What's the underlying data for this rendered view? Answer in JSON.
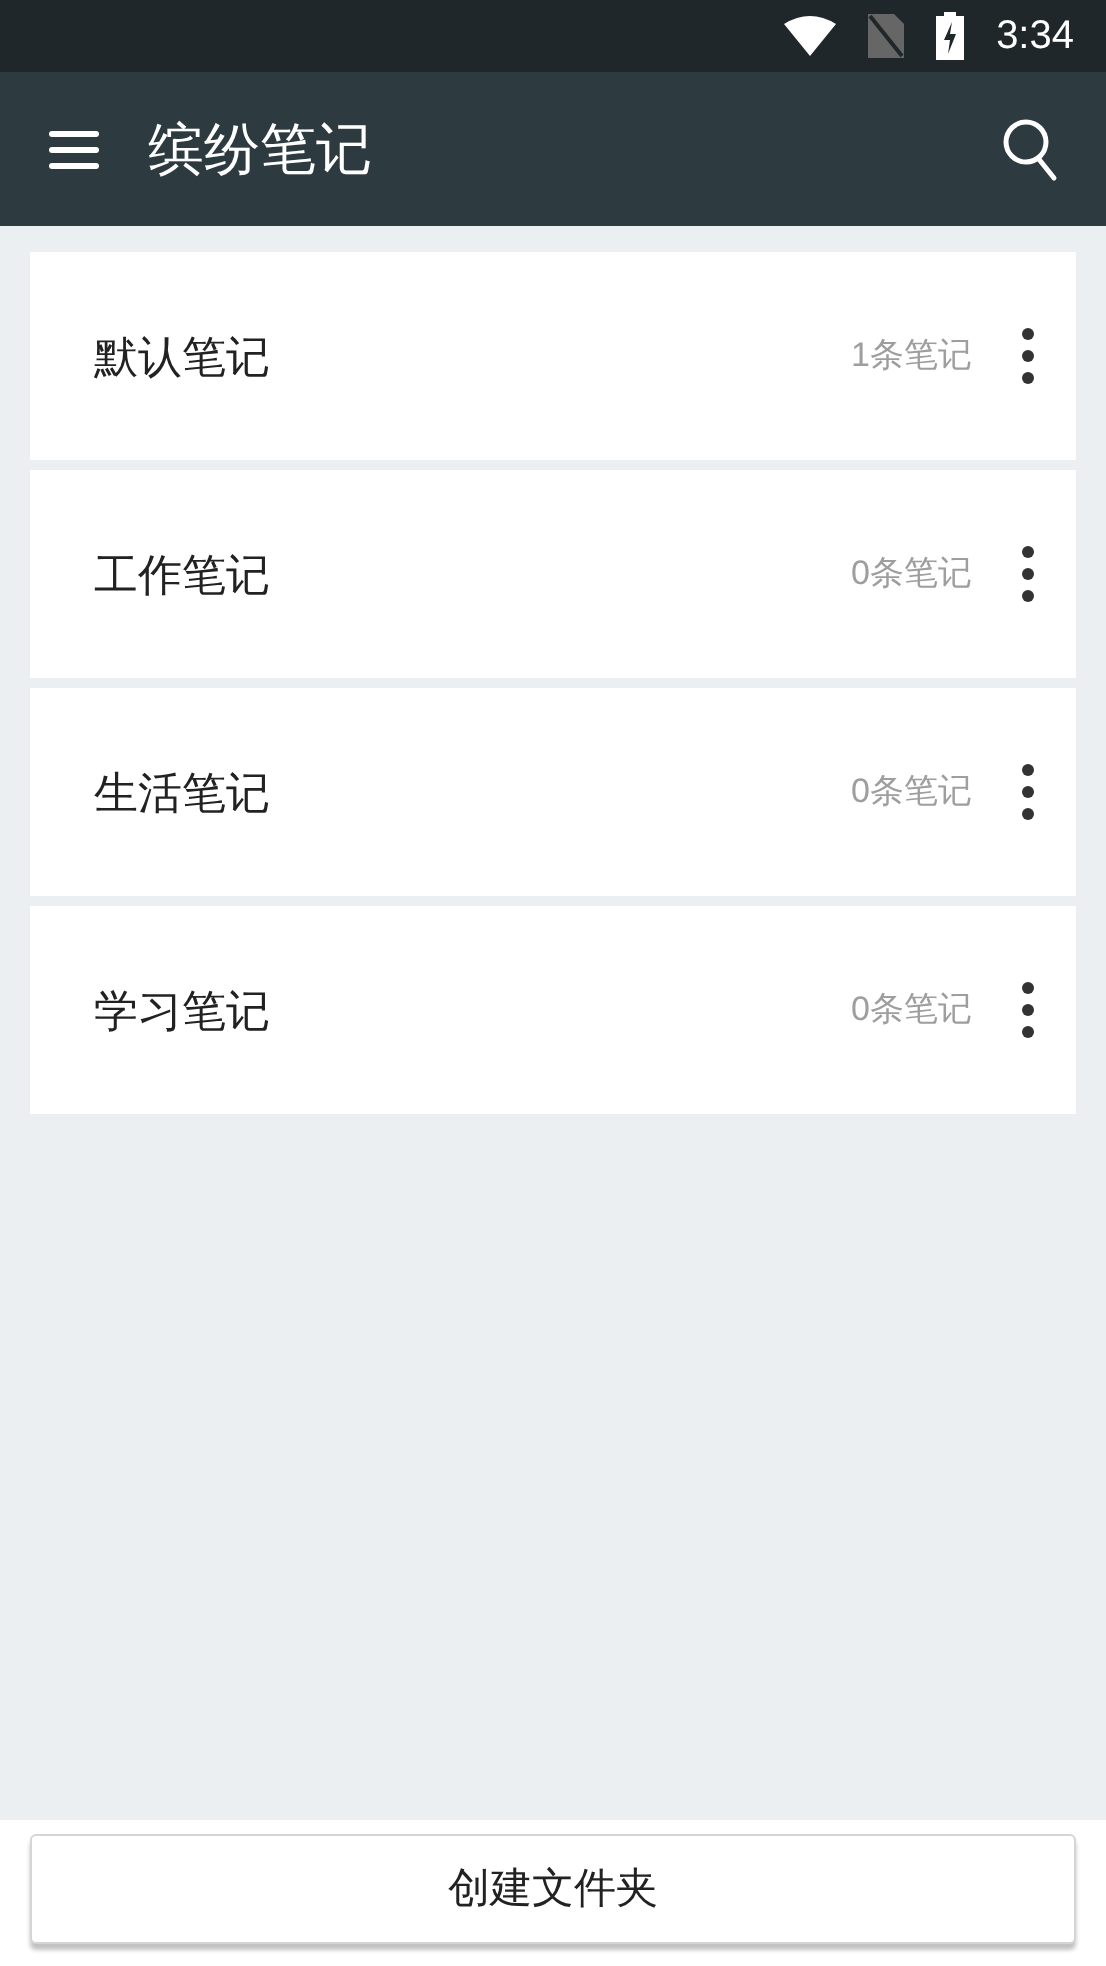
{
  "status_bar": {
    "time": "3:34"
  },
  "app_bar": {
    "title": "缤纷笔记"
  },
  "folders": [
    {
      "name": "默认笔记",
      "count": "1条笔记"
    },
    {
      "name": "工作笔记",
      "count": "0条笔记"
    },
    {
      "name": "生活笔记",
      "count": "0条笔记"
    },
    {
      "name": "学习笔记",
      "count": "0条笔记"
    }
  ],
  "create_button": {
    "label": "创建文件夹"
  }
}
